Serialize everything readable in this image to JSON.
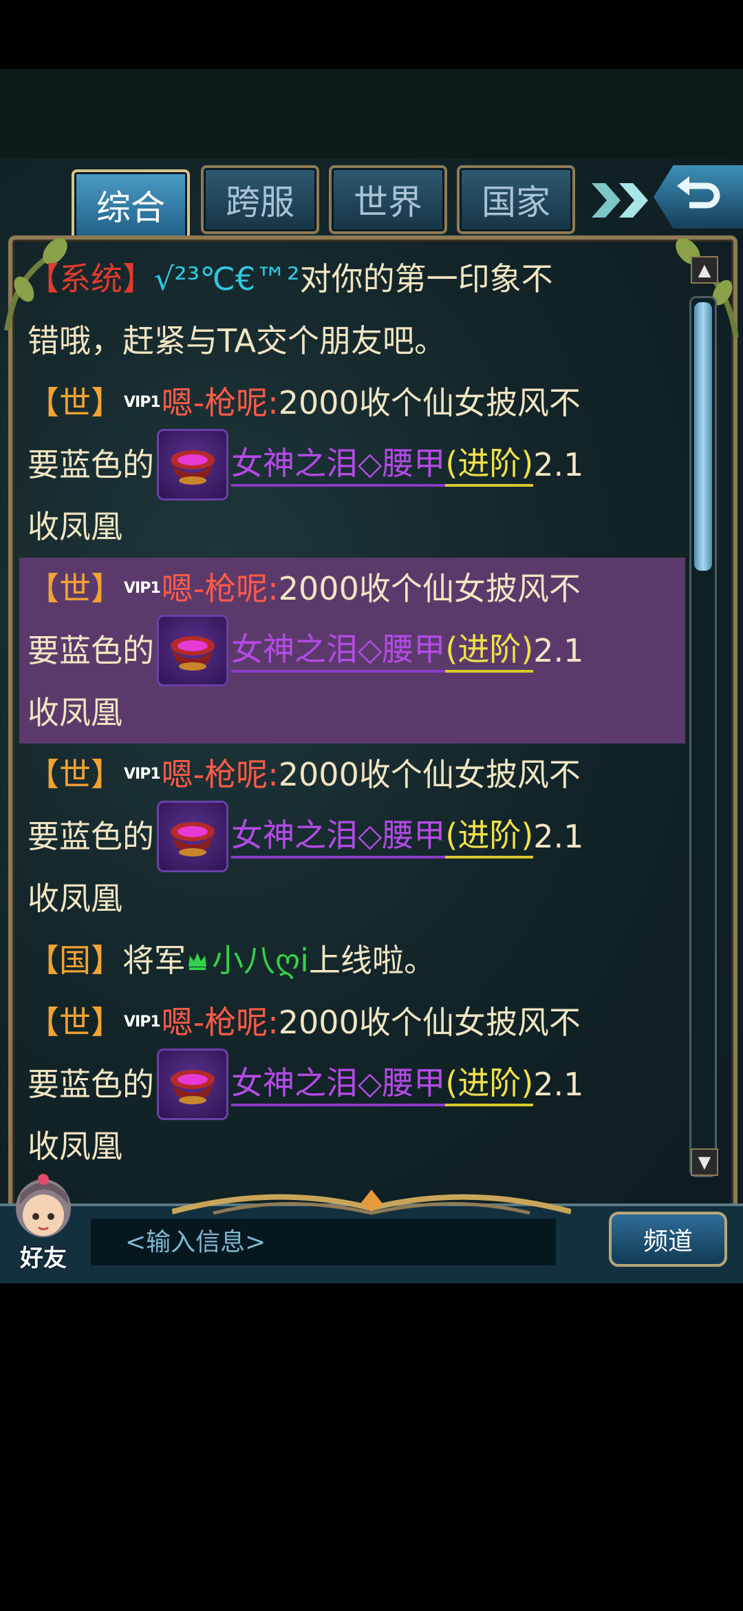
{
  "tabs": [
    {
      "label": "综合",
      "active": true
    },
    {
      "label": "跨服",
      "active": false
    },
    {
      "label": "世界",
      "active": false
    },
    {
      "label": "国家",
      "active": false
    }
  ],
  "messages": [
    {
      "channel": "【系统】",
      "name": "√²³℃€™²",
      "text1": " 对你的第一印象不",
      "text2": "错哦，赶紧与TA交个朋友吧。"
    },
    {
      "channel": "【世】",
      "vip": "VIP1",
      "name": "嗯-枪呢:",
      "text1": " 2000收个仙女披风不",
      "pre_item": "要蓝色的",
      "item_name": "女神之泪◇腰甲",
      "item_tag": "(进阶)",
      "after": "2.1",
      "text3": "收凤凰",
      "highlighted": false
    },
    {
      "channel": "【世】",
      "vip": "VIP1",
      "name": "嗯-枪呢:",
      "text1": " 2000收个仙女披风不",
      "pre_item": "要蓝色的",
      "item_name": "女神之泪◇腰甲",
      "item_tag": "(进阶)",
      "after": "2.1",
      "text3": "收凤凰",
      "highlighted": true
    },
    {
      "channel": "【世】",
      "vip": "VIP1",
      "name": "嗯-枪呢:",
      "text1": " 2000收个仙女披风不",
      "pre_item": "要蓝色的",
      "item_name": "女神之泪◇腰甲",
      "item_tag": "(进阶)",
      "after": "2.1",
      "text3": "收凤凰",
      "highlighted": false
    },
    {
      "channel": "【国】",
      "prefix": "将军 ",
      "icon": "crown-icon",
      "name": "小八ღi",
      "text1": " 上线啦。"
    },
    {
      "channel": "【世】",
      "vip": "VIP1",
      "name": "嗯-枪呢:",
      "text1": " 2000收个仙女披风不",
      "pre_item": "要蓝色的",
      "item_name": "女神之泪◇腰甲",
      "item_tag": "(进阶)",
      "after": "2.1",
      "text3": "收凤凰",
      "highlighted": false
    }
  ],
  "input": {
    "placeholder": "<输入信息>"
  },
  "channel_button": "频道",
  "friends_label": "好友",
  "colors": {
    "system_bracket": "#e03b2e",
    "world_bracket": "#f2a334",
    "player_name": "#ff5a48",
    "item_name": "#b54be6",
    "item_tag": "#f0e14a",
    "highlight_row": "#5b3a6b"
  }
}
